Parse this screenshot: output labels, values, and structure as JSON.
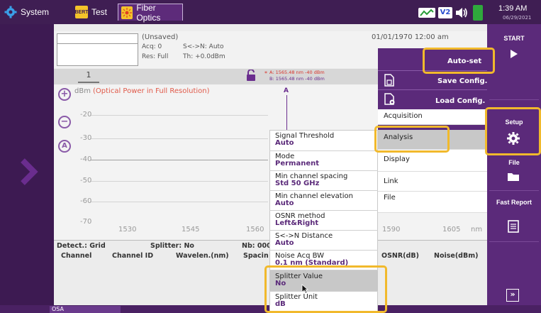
{
  "topbar": {
    "tab_system": "System",
    "tab_test": "Test",
    "tab_test_icon": "BERT",
    "tab_fiber": "Fiber Optics",
    "time": "1:39 AM",
    "date": "06/29/2021",
    "v2_badge": "V2"
  },
  "header": {
    "status": "(Unsaved)",
    "acq": "Acq: 0",
    "sn": "S<->N: Auto",
    "res": "Res: Full",
    "th": "Th: +0.0dBm",
    "datetime": "01/01/1970 12:00 am",
    "trace_number": "1"
  },
  "markers": {
    "a": "A: 1565.48 nm -40 dBm",
    "b": "B: 1565.48 nm -40 dBm",
    "star": "*",
    "label": "A"
  },
  "graph": {
    "ylabel_unit": "dBm",
    "ylabel_desc": "(Optical Power in Full Resolution)",
    "y_ticks": [
      "-20",
      "-30",
      "-40",
      "-50",
      "-60",
      "-70"
    ],
    "x_ticks": [
      "1530",
      "1545",
      "1560",
      "1590",
      "1605"
    ],
    "x_unit": "nm"
  },
  "table": {
    "detect": "Detect.: Grid",
    "splitter": "Splitter: No",
    "nb": "Nb: 000",
    "columns": [
      "Channel",
      "Channel ID",
      "Wavelen.(nm)",
      "Spacin",
      "OSNR(dB)",
      "Noise(dBm)"
    ]
  },
  "rightbar": {
    "start": "START",
    "setup": "Setup",
    "file": "File",
    "fast_report": "Fast Report"
  },
  "menu": {
    "autoset": "Auto-set",
    "save_config": "Save Config.",
    "load_config": "Load Config.",
    "acquisition": "Acquisition",
    "analysis": "Analysis",
    "display": "Display",
    "link": "Link",
    "file": "File"
  },
  "analysis_list": [
    {
      "label": "Signal Threshold",
      "value": "Auto"
    },
    {
      "label": "Mode",
      "value": "Permanent"
    },
    {
      "label": "Min channel spacing",
      "value": "Std 50 GHz"
    },
    {
      "label": "Min channel elevation",
      "value": "Auto"
    },
    {
      "label": "OSNR method",
      "value": "Left&Right"
    },
    {
      "label": "S<->N Distance",
      "value": "Auto"
    },
    {
      "label": "Noise Acq BW",
      "value": "0.1 nm (Standard)"
    },
    {
      "label": "Splitter Value",
      "value": "No"
    },
    {
      "label": "Splitter Unit",
      "value": "dB"
    }
  ],
  "bottom": {
    "osa_tab": "OSA"
  },
  "colors": {
    "brand_purple": "#5b2a7a",
    "highlight": "#f1b92c",
    "marker_red": "#d9342b"
  }
}
